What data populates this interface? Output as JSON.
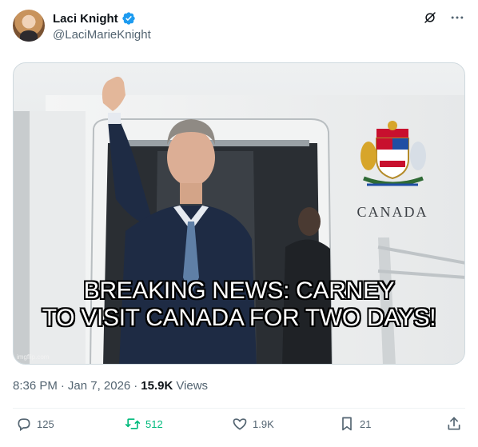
{
  "author": {
    "display_name": "Laci Knight",
    "handle": "@LaciMarieKnight"
  },
  "icons": {
    "verified": "verified-badge-icon",
    "grok": "grok-icon",
    "more": "more-options-icon",
    "reply": "reply-icon",
    "retweet": "retweet-icon",
    "like": "like-icon",
    "bookmark": "bookmark-icon",
    "share": "share-icon"
  },
  "colors": {
    "verified": "#1d9bf0",
    "retweet_active": "#00ba7c",
    "secondary_text": "#536471"
  },
  "media": {
    "caption_line1": "BREAKING NEWS: CARNEY",
    "caption_line2": "TO VISIT CANADA FOR TWO DAYS!",
    "plane_text": "CANADA",
    "watermark": "imgflip.com"
  },
  "meta": {
    "time": "8:36 PM",
    "separator": "·",
    "date": "Jan 7, 2026",
    "views_count": "15.9K",
    "views_label": "Views"
  },
  "actions": {
    "replies": "125",
    "retweets": "512",
    "likes": "1.9K",
    "bookmarks": "21"
  }
}
